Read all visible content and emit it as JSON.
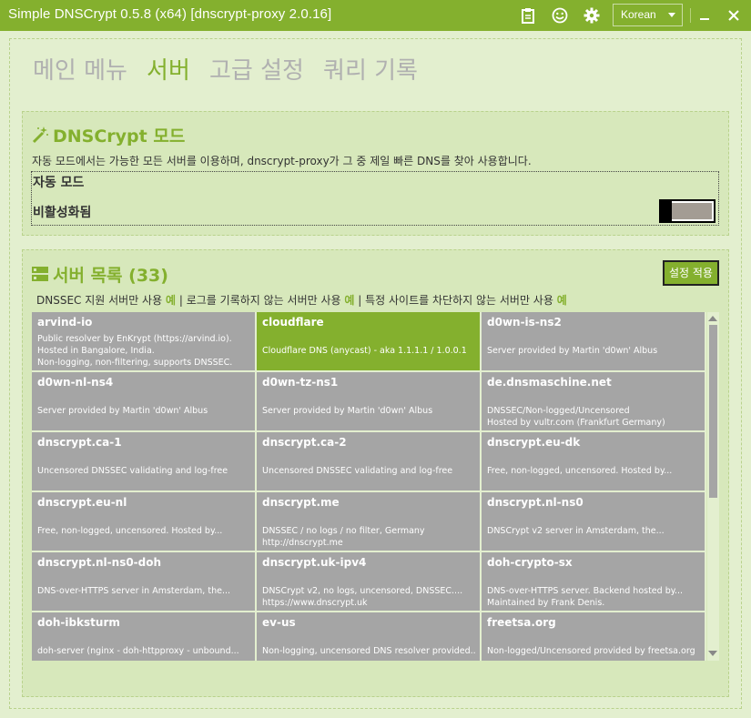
{
  "window": {
    "title": "Simple DNSCrypt 0.5.8 (x64) [dnscrypt-proxy 2.0.16]",
    "language": "Korean",
    "accent_color": "#84b02e",
    "icons": [
      "clipboard-icon",
      "smiley-icon",
      "gear-icon",
      "minimize-icon",
      "close-icon"
    ]
  },
  "tabs": [
    {
      "label": "메인 메뉴",
      "active": false
    },
    {
      "label": "서버",
      "active": true
    },
    {
      "label": "고급 설정",
      "active": false
    },
    {
      "label": "쿼리 기록",
      "active": false
    }
  ],
  "dnscrypt_mode": {
    "title": "DNSCrypt 모드",
    "description": "자동 모드에서는 가능한 모든 서버를 이용하며, dnscrypt-proxy가 그 중 제일 빠른 DNS를 찾아 사용합니다.",
    "mode_label": "자동 모드",
    "status": "비활성화됨",
    "enabled": false
  },
  "server_list": {
    "title": "서버 목록 (33)",
    "apply_button": "설정 적용",
    "filters": {
      "dnssec_text": "DNSSEC 지원 서버만 사용",
      "dnssec_value": "예",
      "sep1": "|",
      "nolog_text": "로그를 기록하지 않는 서버만 사용",
      "nolog_value": "예",
      "sep2": "|",
      "nofilter_text": "특정 사이트를 차단하지 않는 서버만 사용",
      "nofilter_value": "예"
    },
    "servers": [
      {
        "name": "arvind-io",
        "desc": "Public resolver by EnKrypt (https://arvind.io).\nHosted in Bangalore, India.\nNon-logging, non-filtering, supports DNSSEC.",
        "selected": false
      },
      {
        "name": "cloudflare",
        "desc": "\nCloudflare DNS (anycast) - aka 1.1.1.1 / 1.0.0.1",
        "selected": true
      },
      {
        "name": "d0wn-is-ns2",
        "desc": "\nServer provided by Martin 'd0wn' Albus",
        "selected": false
      },
      {
        "name": "d0wn-nl-ns4",
        "desc": "\nServer provided by Martin 'd0wn' Albus",
        "selected": false
      },
      {
        "name": "d0wn-tz-ns1",
        "desc": "\nServer provided by Martin 'd0wn' Albus",
        "selected": false
      },
      {
        "name": "de.dnsmaschine.net",
        "desc": "\nDNSSEC/Non-logged/Uncensored\nHosted by vultr.com (Frankfurt Germany)",
        "selected": false
      },
      {
        "name": "dnscrypt.ca-1",
        "desc": "\nUncensored DNSSEC validating and log-free",
        "selected": false
      },
      {
        "name": "dnscrypt.ca-2",
        "desc": "\nUncensored DNSSEC validating and log-free",
        "selected": false
      },
      {
        "name": "dnscrypt.eu-dk",
        "desc": "\nFree, non-logged, uncensored. Hosted by...",
        "selected": false
      },
      {
        "name": "dnscrypt.eu-nl",
        "desc": "\nFree, non-logged, uncensored. Hosted by...",
        "selected": false
      },
      {
        "name": "dnscrypt.me",
        "desc": "\nDNSSEC / no logs / no filter, Germany\nhttp://dnscrypt.me",
        "selected": false
      },
      {
        "name": "dnscrypt.nl-ns0",
        "desc": "\nDNSCrypt v2 server in Amsterdam, the...",
        "selected": false
      },
      {
        "name": "dnscrypt.nl-ns0-doh",
        "desc": "\nDNS-over-HTTPS server in Amsterdam, the...",
        "selected": false
      },
      {
        "name": "dnscrypt.uk-ipv4",
        "desc": "\nDNSCrypt v2, no logs, uncensored, DNSSEC....\nhttps://www.dnscrypt.uk",
        "selected": false
      },
      {
        "name": "doh-crypto-sx",
        "desc": "\nDNS-over-HTTPS server. Backend hosted by...\nMaintained by Frank Denis.",
        "selected": false
      },
      {
        "name": "doh-ibksturm",
        "desc": "\ndoh-server (nginx - doh-httpproxy - unbound...",
        "selected": false
      },
      {
        "name": "ev-us",
        "desc": "\nNon-logging, uncensored DNS resolver provided...",
        "selected": false
      },
      {
        "name": "freetsa.org",
        "desc": "\nNon-logged/Uncensored provided by freetsa.org",
        "selected": false
      }
    ]
  }
}
